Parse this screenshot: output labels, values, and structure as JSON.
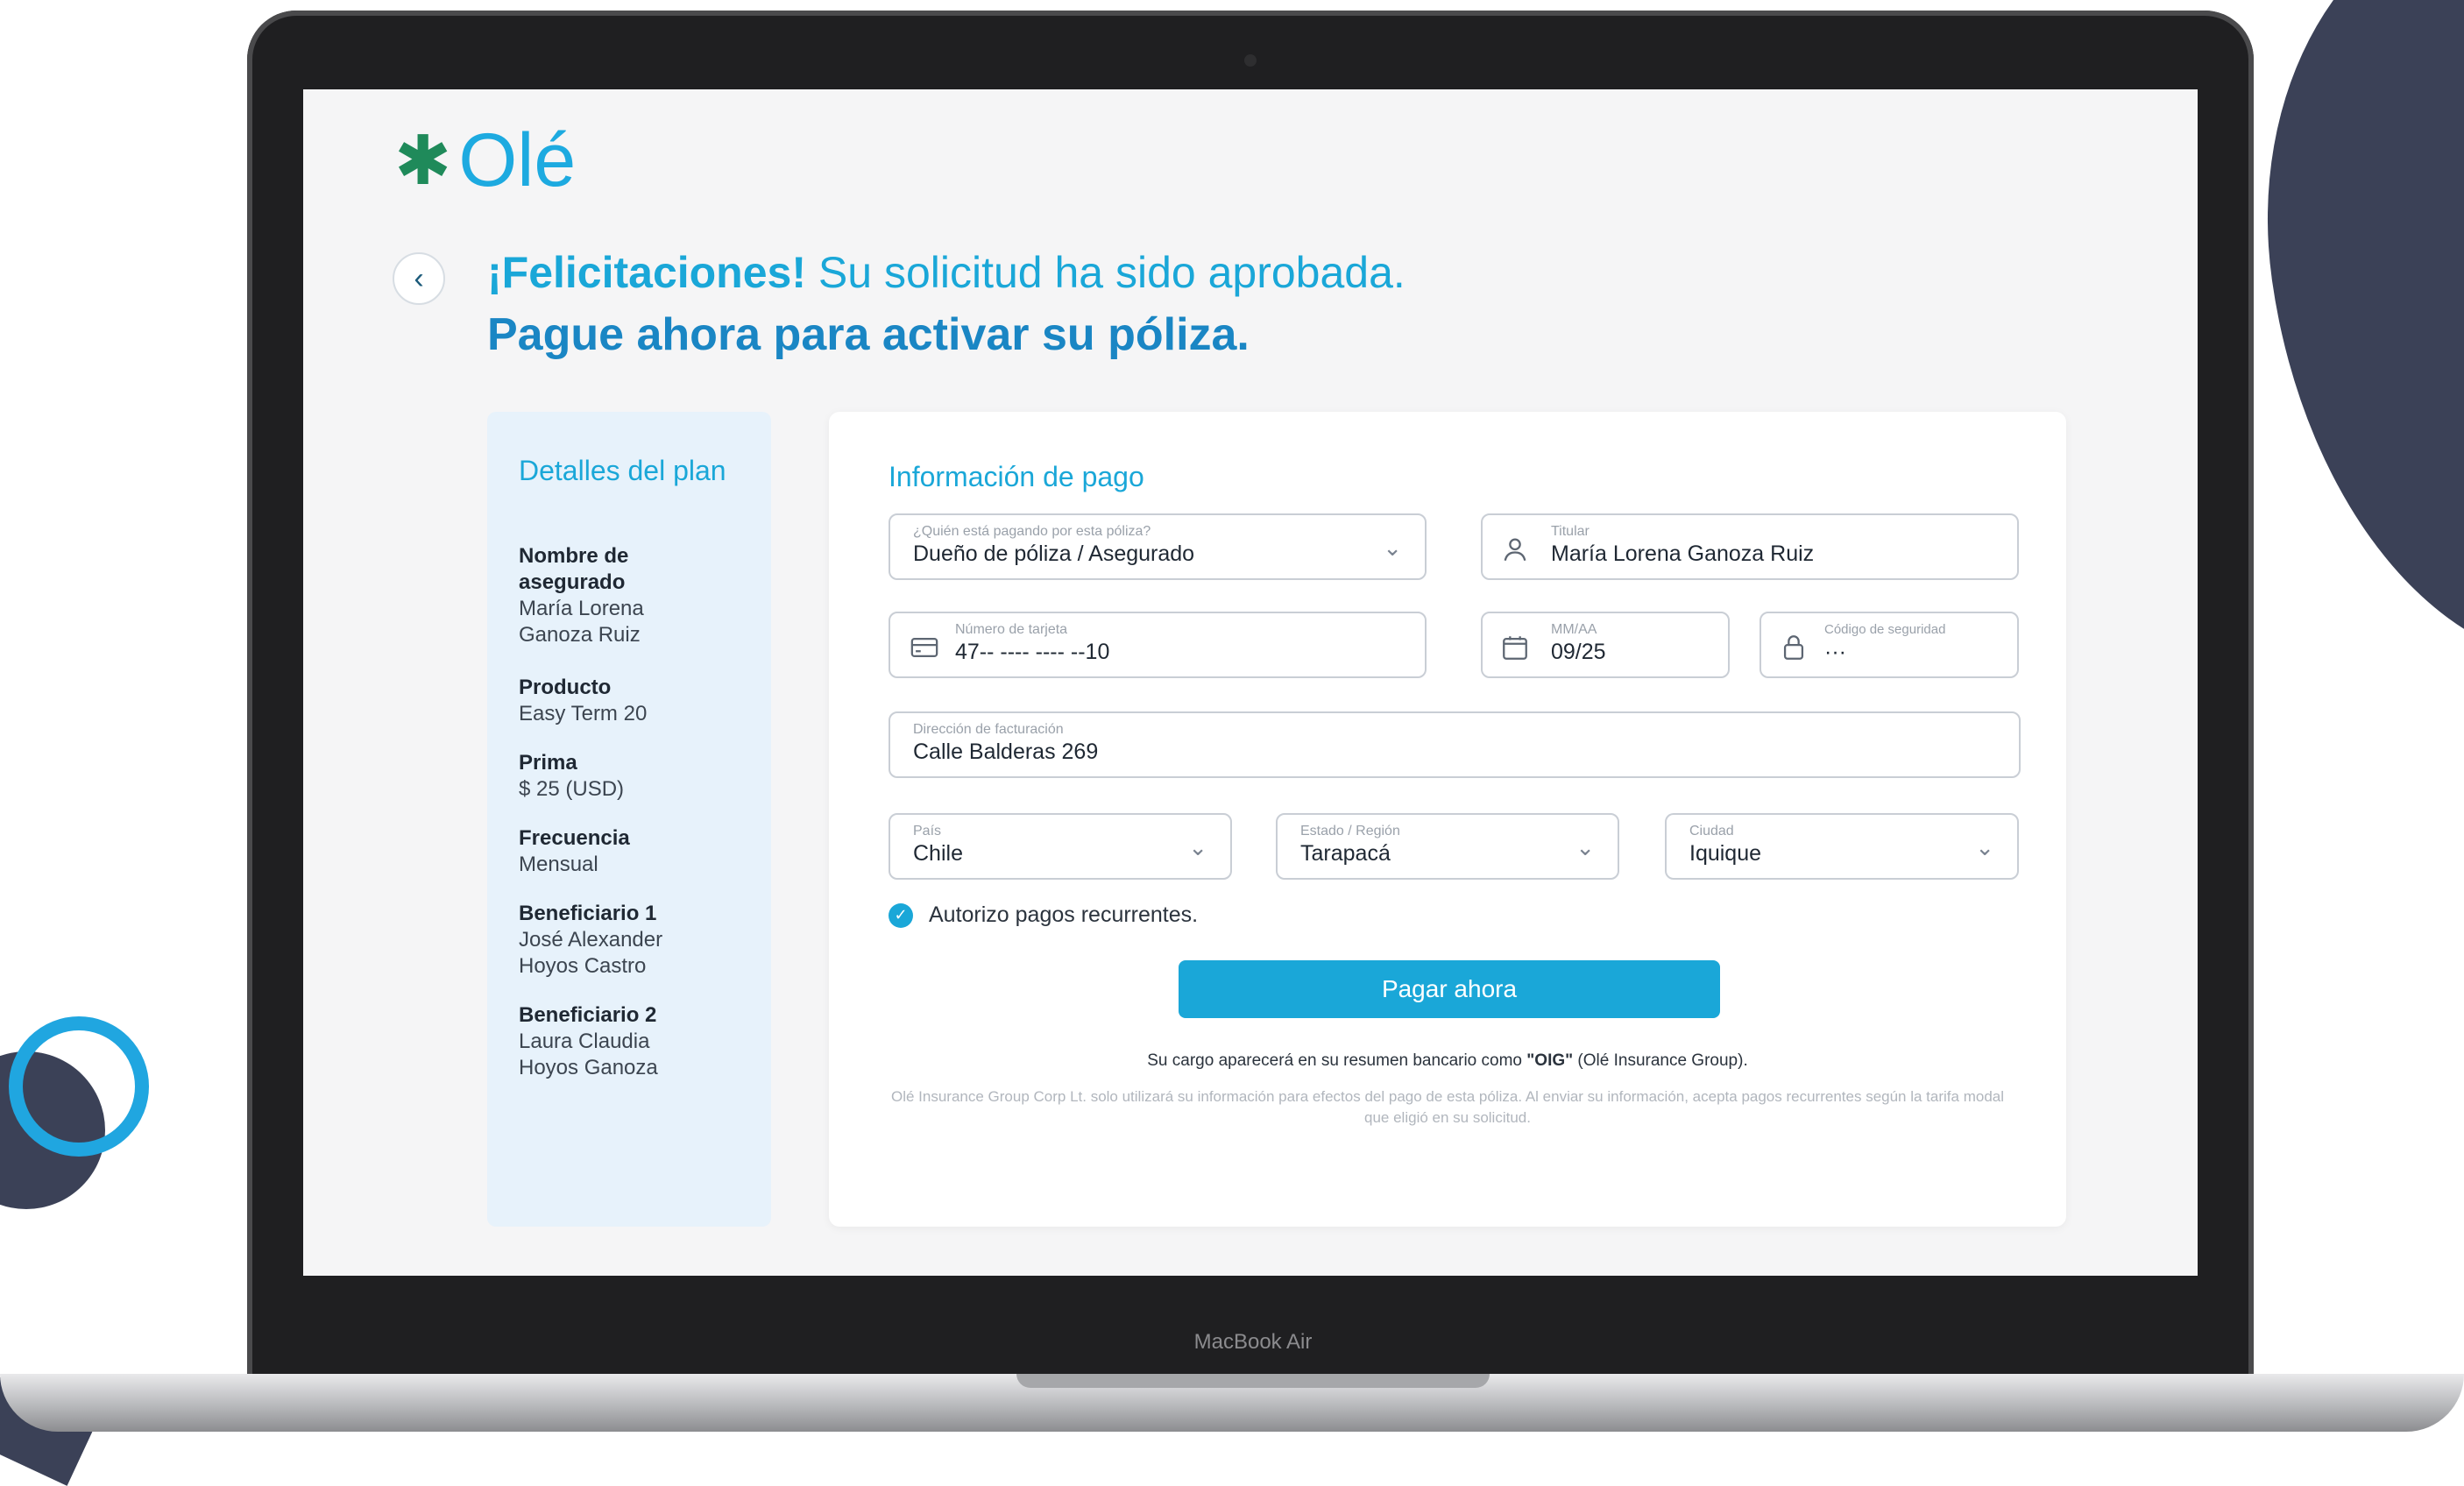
{
  "brand": {
    "logo_text": "Olé",
    "logo_symbol": "✱",
    "accent": "#1aa7d8"
  },
  "header": {
    "headline_bold": "¡Felicitaciones!",
    "headline_rest": " Su solicitud ha sido aprobada.",
    "subheadline": "Pague ahora para activar su póliza."
  },
  "plan": {
    "title": "Detalles del plan",
    "items": [
      {
        "label": "Nombre de asegurado",
        "value": "María Lorena Ganoza Ruiz"
      },
      {
        "label": "Producto",
        "value": "Easy Term 20"
      },
      {
        "label": "Prima",
        "value": "$ 25 (USD)"
      },
      {
        "label": "Frecuencia",
        "value": "Mensual"
      },
      {
        "label": "Beneficiario 1",
        "value": "José Alexander Hoyos Castro"
      },
      {
        "label": "Beneficiario 2",
        "value": "Laura Claudia Hoyos Ganoza"
      }
    ]
  },
  "payment": {
    "title": "Información de pago",
    "payer": {
      "label": "¿Quién está pagando por esta póliza?",
      "value": "Dueño de póliza / Asegurado"
    },
    "holder": {
      "label": "Titular",
      "value": "María Lorena Ganoza Ruiz"
    },
    "card_number": {
      "label": "Número de tarjeta",
      "value": "47-- ---- ---- --10"
    },
    "expiry": {
      "label": "MM/AA",
      "value": "09/25"
    },
    "cvv": {
      "label": "Código de seguridad",
      "value": "···"
    },
    "address": {
      "label": "Dirección de facturación",
      "value": "Calle Balderas 269"
    },
    "country": {
      "label": "País",
      "value": "Chile"
    },
    "region": {
      "label": "Estado / Región",
      "value": "Tarapacá"
    },
    "city": {
      "label": "Ciudad",
      "value": "Iquique"
    },
    "recurring_label": "Autorizo pagos recurrentes.",
    "recurring_checked": true,
    "pay_button": "Pagar ahora",
    "charge_note_pre": "Su cargo aparecerá en su resumen bancario como ",
    "charge_note_bold": "\"OIG\"",
    "charge_note_post": " (Olé Insurance Group).",
    "disclaimer": "Olé Insurance Group Corp Lt. solo utilizará su información para efectos del pago de esta póliza. Al enviar su información, acepta pagos recurrentes según la tarifa modal que eligió en su solicitud."
  },
  "device": {
    "brand_label": "MacBook Air"
  },
  "icons": {
    "back": "chevron-left-icon",
    "user": "user-icon",
    "card": "credit-card-icon",
    "calendar": "calendar-icon",
    "lock": "lock-icon",
    "chevron": "chevron-down-icon",
    "check": "check-circle-icon"
  }
}
